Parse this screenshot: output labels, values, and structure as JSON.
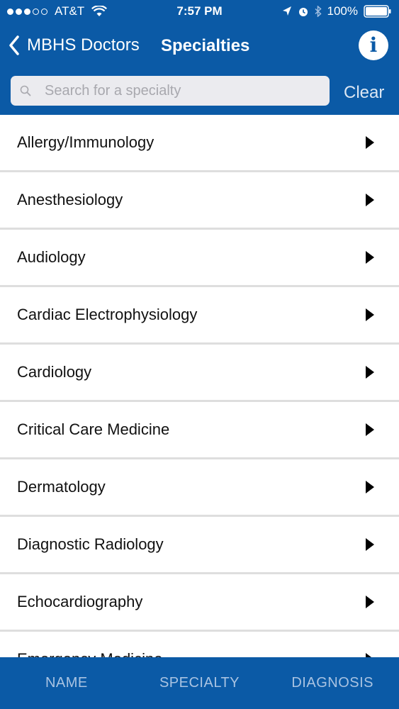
{
  "status_bar": {
    "carrier": "AT&T",
    "time": "7:57 PM",
    "battery": "100%",
    "icons": [
      "signal-dots",
      "wifi-icon",
      "location-icon",
      "alarm-icon",
      "bluetooth-icon",
      "battery-icon"
    ]
  },
  "nav": {
    "back_label": "MBHS Doctors",
    "title": "Specialties",
    "info_glyph": "i"
  },
  "search": {
    "placeholder": "Search for a specialty",
    "value": "",
    "clear_label": "Clear"
  },
  "specialties": [
    {
      "label": "Allergy/Immunology"
    },
    {
      "label": "Anesthesiology"
    },
    {
      "label": "Audiology"
    },
    {
      "label": "Cardiac Electrophysiology"
    },
    {
      "label": "Cardiology"
    },
    {
      "label": "Critical Care Medicine"
    },
    {
      "label": "Dermatology"
    },
    {
      "label": "Diagnostic Radiology"
    },
    {
      "label": "Echocardiography"
    },
    {
      "label": "Emergency Medicine"
    }
  ],
  "tabs": [
    {
      "label": "NAME"
    },
    {
      "label": "SPECIALTY"
    },
    {
      "label": "DIAGNOSIS"
    }
  ],
  "colors": {
    "brand_blue": "#0b5aa6",
    "tab_text": "#a9c3e2"
  }
}
